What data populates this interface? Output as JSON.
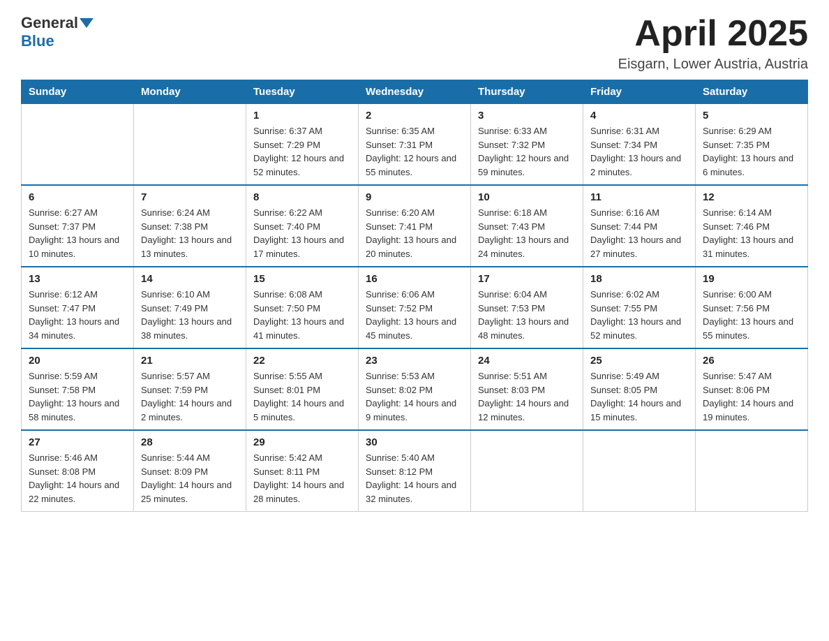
{
  "header": {
    "logo": {
      "general": "General",
      "blue": "Blue"
    },
    "title": "April 2025",
    "location": "Eisgarn, Lower Austria, Austria"
  },
  "days_of_week": [
    "Sunday",
    "Monday",
    "Tuesday",
    "Wednesday",
    "Thursday",
    "Friday",
    "Saturday"
  ],
  "weeks": [
    [
      {
        "day": "",
        "info": ""
      },
      {
        "day": "",
        "info": ""
      },
      {
        "day": "1",
        "info": "Sunrise: 6:37 AM\nSunset: 7:29 PM\nDaylight: 12 hours and 52 minutes."
      },
      {
        "day": "2",
        "info": "Sunrise: 6:35 AM\nSunset: 7:31 PM\nDaylight: 12 hours and 55 minutes."
      },
      {
        "day": "3",
        "info": "Sunrise: 6:33 AM\nSunset: 7:32 PM\nDaylight: 12 hours and 59 minutes."
      },
      {
        "day": "4",
        "info": "Sunrise: 6:31 AM\nSunset: 7:34 PM\nDaylight: 13 hours and 2 minutes."
      },
      {
        "day": "5",
        "info": "Sunrise: 6:29 AM\nSunset: 7:35 PM\nDaylight: 13 hours and 6 minutes."
      }
    ],
    [
      {
        "day": "6",
        "info": "Sunrise: 6:27 AM\nSunset: 7:37 PM\nDaylight: 13 hours and 10 minutes."
      },
      {
        "day": "7",
        "info": "Sunrise: 6:24 AM\nSunset: 7:38 PM\nDaylight: 13 hours and 13 minutes."
      },
      {
        "day": "8",
        "info": "Sunrise: 6:22 AM\nSunset: 7:40 PM\nDaylight: 13 hours and 17 minutes."
      },
      {
        "day": "9",
        "info": "Sunrise: 6:20 AM\nSunset: 7:41 PM\nDaylight: 13 hours and 20 minutes."
      },
      {
        "day": "10",
        "info": "Sunrise: 6:18 AM\nSunset: 7:43 PM\nDaylight: 13 hours and 24 minutes."
      },
      {
        "day": "11",
        "info": "Sunrise: 6:16 AM\nSunset: 7:44 PM\nDaylight: 13 hours and 27 minutes."
      },
      {
        "day": "12",
        "info": "Sunrise: 6:14 AM\nSunset: 7:46 PM\nDaylight: 13 hours and 31 minutes."
      }
    ],
    [
      {
        "day": "13",
        "info": "Sunrise: 6:12 AM\nSunset: 7:47 PM\nDaylight: 13 hours and 34 minutes."
      },
      {
        "day": "14",
        "info": "Sunrise: 6:10 AM\nSunset: 7:49 PM\nDaylight: 13 hours and 38 minutes."
      },
      {
        "day": "15",
        "info": "Sunrise: 6:08 AM\nSunset: 7:50 PM\nDaylight: 13 hours and 41 minutes."
      },
      {
        "day": "16",
        "info": "Sunrise: 6:06 AM\nSunset: 7:52 PM\nDaylight: 13 hours and 45 minutes."
      },
      {
        "day": "17",
        "info": "Sunrise: 6:04 AM\nSunset: 7:53 PM\nDaylight: 13 hours and 48 minutes."
      },
      {
        "day": "18",
        "info": "Sunrise: 6:02 AM\nSunset: 7:55 PM\nDaylight: 13 hours and 52 minutes."
      },
      {
        "day": "19",
        "info": "Sunrise: 6:00 AM\nSunset: 7:56 PM\nDaylight: 13 hours and 55 minutes."
      }
    ],
    [
      {
        "day": "20",
        "info": "Sunrise: 5:59 AM\nSunset: 7:58 PM\nDaylight: 13 hours and 58 minutes."
      },
      {
        "day": "21",
        "info": "Sunrise: 5:57 AM\nSunset: 7:59 PM\nDaylight: 14 hours and 2 minutes."
      },
      {
        "day": "22",
        "info": "Sunrise: 5:55 AM\nSunset: 8:01 PM\nDaylight: 14 hours and 5 minutes."
      },
      {
        "day": "23",
        "info": "Sunrise: 5:53 AM\nSunset: 8:02 PM\nDaylight: 14 hours and 9 minutes."
      },
      {
        "day": "24",
        "info": "Sunrise: 5:51 AM\nSunset: 8:03 PM\nDaylight: 14 hours and 12 minutes."
      },
      {
        "day": "25",
        "info": "Sunrise: 5:49 AM\nSunset: 8:05 PM\nDaylight: 14 hours and 15 minutes."
      },
      {
        "day": "26",
        "info": "Sunrise: 5:47 AM\nSunset: 8:06 PM\nDaylight: 14 hours and 19 minutes."
      }
    ],
    [
      {
        "day": "27",
        "info": "Sunrise: 5:46 AM\nSunset: 8:08 PM\nDaylight: 14 hours and 22 minutes."
      },
      {
        "day": "28",
        "info": "Sunrise: 5:44 AM\nSunset: 8:09 PM\nDaylight: 14 hours and 25 minutes."
      },
      {
        "day": "29",
        "info": "Sunrise: 5:42 AM\nSunset: 8:11 PM\nDaylight: 14 hours and 28 minutes."
      },
      {
        "day": "30",
        "info": "Sunrise: 5:40 AM\nSunset: 8:12 PM\nDaylight: 14 hours and 32 minutes."
      },
      {
        "day": "",
        "info": ""
      },
      {
        "day": "",
        "info": ""
      },
      {
        "day": "",
        "info": ""
      }
    ]
  ]
}
